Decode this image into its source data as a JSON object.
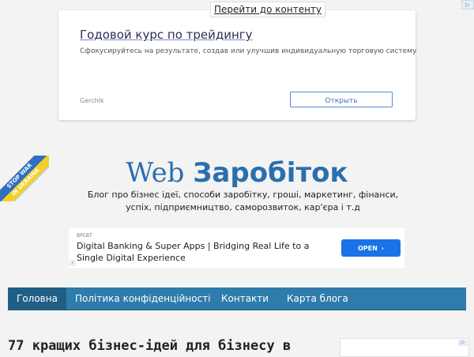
{
  "skip_link": "Перейти до контенту",
  "top_ad": {
    "title": "Годовой курс по трейдингу",
    "description": "Сфокусируйтесь на результате, создав или улучшив индивидуальную торговую систему",
    "brand": "Gerchik",
    "button_label": "Открыть"
  },
  "header": {
    "ribbon_text": [
      "STOP WAR",
      "IN UKRAINE"
    ],
    "logo_part1": "Web",
    "logo_part2": "Заробіток",
    "tagline": "Блог про бізнес ідеї, способи заробітку, гроші, маркетинг, фінанси, успіх, підприємництво, саморозвиток, кар'єра і т.д"
  },
  "banner_ad": {
    "sponsor": "BPCBT",
    "headline": "Digital Banking & Super Apps | Bridging Real Life to a Single Digital Experience",
    "button_label": "OPEN"
  },
  "nav": {
    "items": [
      "Головна",
      "Політика конфіденційності",
      "Контакти",
      "Карта блога"
    ]
  },
  "post": {
    "title": "77 кращих бізнес-ідей для бізнесу в"
  },
  "colors": {
    "brand_blue": "#2b6fad",
    "nav_bg": "#2e7cab",
    "nav_active": "#1f5f86",
    "cta_blue": "#1a73e8"
  },
  "icons": {
    "adchoices": "adchoices-icon",
    "chevron": "chevron-right-icon"
  }
}
